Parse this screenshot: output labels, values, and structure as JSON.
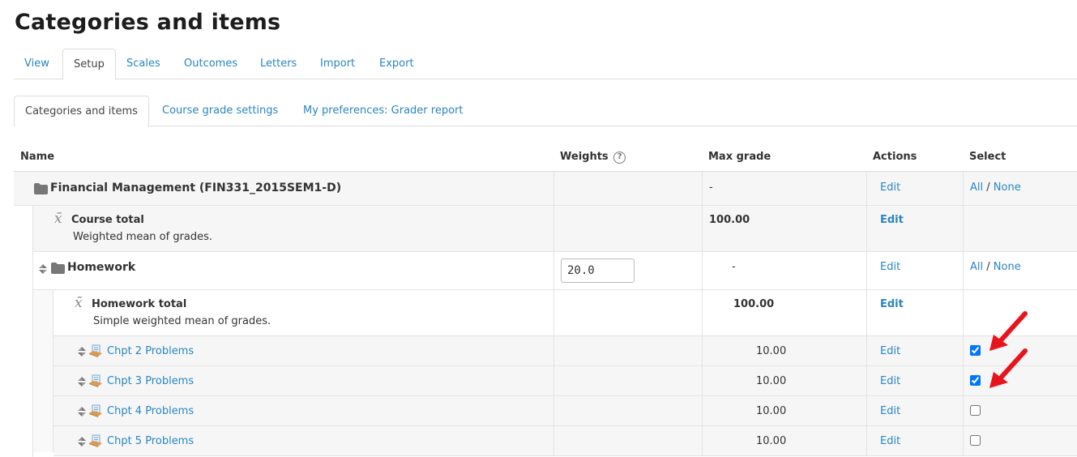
{
  "page": {
    "title": "Categories and items"
  },
  "primary_tabs": [
    {
      "label": "View",
      "active": false
    },
    {
      "label": "Setup",
      "active": true
    },
    {
      "label": "Scales",
      "active": false
    },
    {
      "label": "Outcomes",
      "active": false
    },
    {
      "label": "Letters",
      "active": false
    },
    {
      "label": "Import",
      "active": false
    },
    {
      "label": "Export",
      "active": false
    }
  ],
  "secondary_tabs": [
    {
      "label": "Categories and items",
      "active": true
    },
    {
      "label": "Course grade settings",
      "active": false
    },
    {
      "label": "My preferences: Grader report",
      "active": false
    }
  ],
  "table": {
    "headers": {
      "name": "Name",
      "weights": "Weights",
      "max_grade": "Max grade",
      "actions": "Actions",
      "select": "Select"
    },
    "help_glyph": "?",
    "select_sep": "/",
    "rows": [
      {
        "type": "category",
        "name": "Financial Management (FIN331_2015SEM1-D)",
        "max_grade": "-",
        "action": "Edit",
        "select_all": "All",
        "select_none": "None"
      },
      {
        "type": "total",
        "name": "Course total",
        "desc": "Weighted mean of grades.",
        "max_grade": "100.00",
        "action": "Edit"
      },
      {
        "type": "category",
        "name": "Homework",
        "weight": "20.0",
        "max_grade": "-",
        "action": "Edit",
        "select_all": "All",
        "select_none": "None"
      },
      {
        "type": "total",
        "name": "Homework total",
        "desc": "Simple weighted mean of grades.",
        "max_grade": "100.00",
        "action": "Edit"
      },
      {
        "type": "item",
        "name": "Chpt 2 Problems",
        "max_grade": "10.00",
        "action": "Edit",
        "checked": true
      },
      {
        "type": "item",
        "name": "Chpt 3 Problems",
        "max_grade": "10.00",
        "action": "Edit",
        "checked": true
      },
      {
        "type": "item",
        "name": "Chpt 4 Problems",
        "max_grade": "10.00",
        "action": "Edit",
        "checked": false
      },
      {
        "type": "item",
        "name": "Chpt 5 Problems",
        "max_grade": "10.00",
        "action": "Edit",
        "checked": false
      }
    ]
  },
  "icons": {
    "folder": "folder-icon",
    "mean": "mean-x-bar-icon",
    "move": "move-icon",
    "assignment": "assignment-icon",
    "annotation_arrow": "red-arrow-icon"
  },
  "colors": {
    "link": "#2a86c3",
    "annotation": "#e8141c"
  }
}
